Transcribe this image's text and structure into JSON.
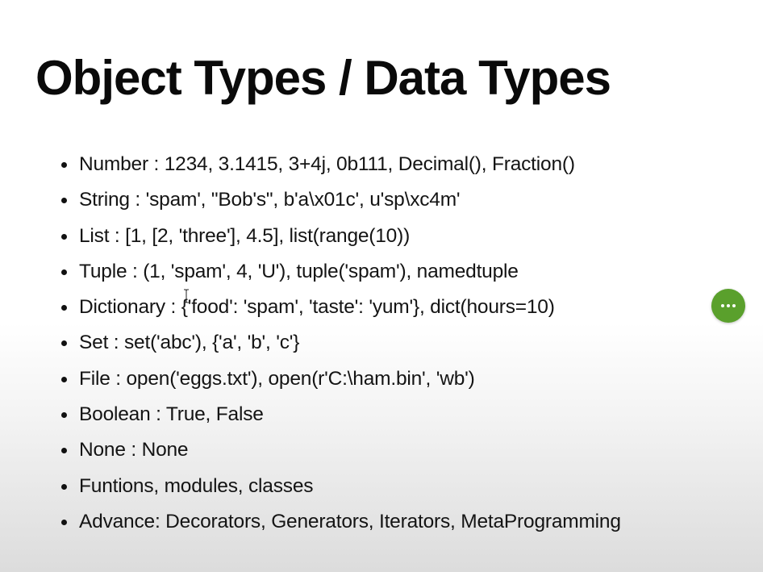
{
  "slide": {
    "title": "Object Types / Data Types",
    "bullets": [
      "Number : 1234, 3.1415, 3+4j, 0b111, Decimal(), Fraction()",
      "String : 'spam', \"Bob's\", b'a\\x01c', u'sp\\xc4m'",
      "List : [1, [2, 'three'], 4.5], list(range(10))",
      "Tuple : (1, 'spam', 4, 'U'), tuple('spam'), namedtuple",
      "Dictionary : {'food': 'spam', 'taste': 'yum'}, dict(hours=10)",
      "Set : set('abc'), {'a', 'b', 'c'}",
      "File : open('eggs.txt'), open(r'C:\\ham.bin', 'wb')",
      "Boolean : True, False",
      "None : None",
      "Funtions, modules, classes",
      "Advance: Decorators, Generators, Iterators, MetaProgramming"
    ]
  },
  "controls": {
    "more_button_icon": "more-horizontal-icon",
    "more_button_color": "#5aa02c",
    "cursor_icon": "text-cursor-icon"
  }
}
